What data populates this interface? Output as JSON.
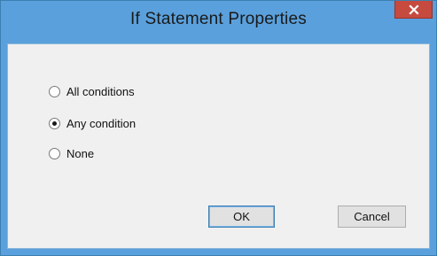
{
  "window": {
    "title": "If Statement Properties",
    "close_glyph": "x"
  },
  "options": [
    {
      "label": "All conditions",
      "selected": false
    },
    {
      "label": "Any condition",
      "selected": true
    },
    {
      "label": "None",
      "selected": false
    }
  ],
  "buttons": {
    "ok_label": "OK",
    "cancel_label": "Cancel"
  },
  "colors": {
    "title_bar": "#5aa0dc",
    "close_button": "#c74a3f",
    "client_background": "#f0f0f0"
  }
}
